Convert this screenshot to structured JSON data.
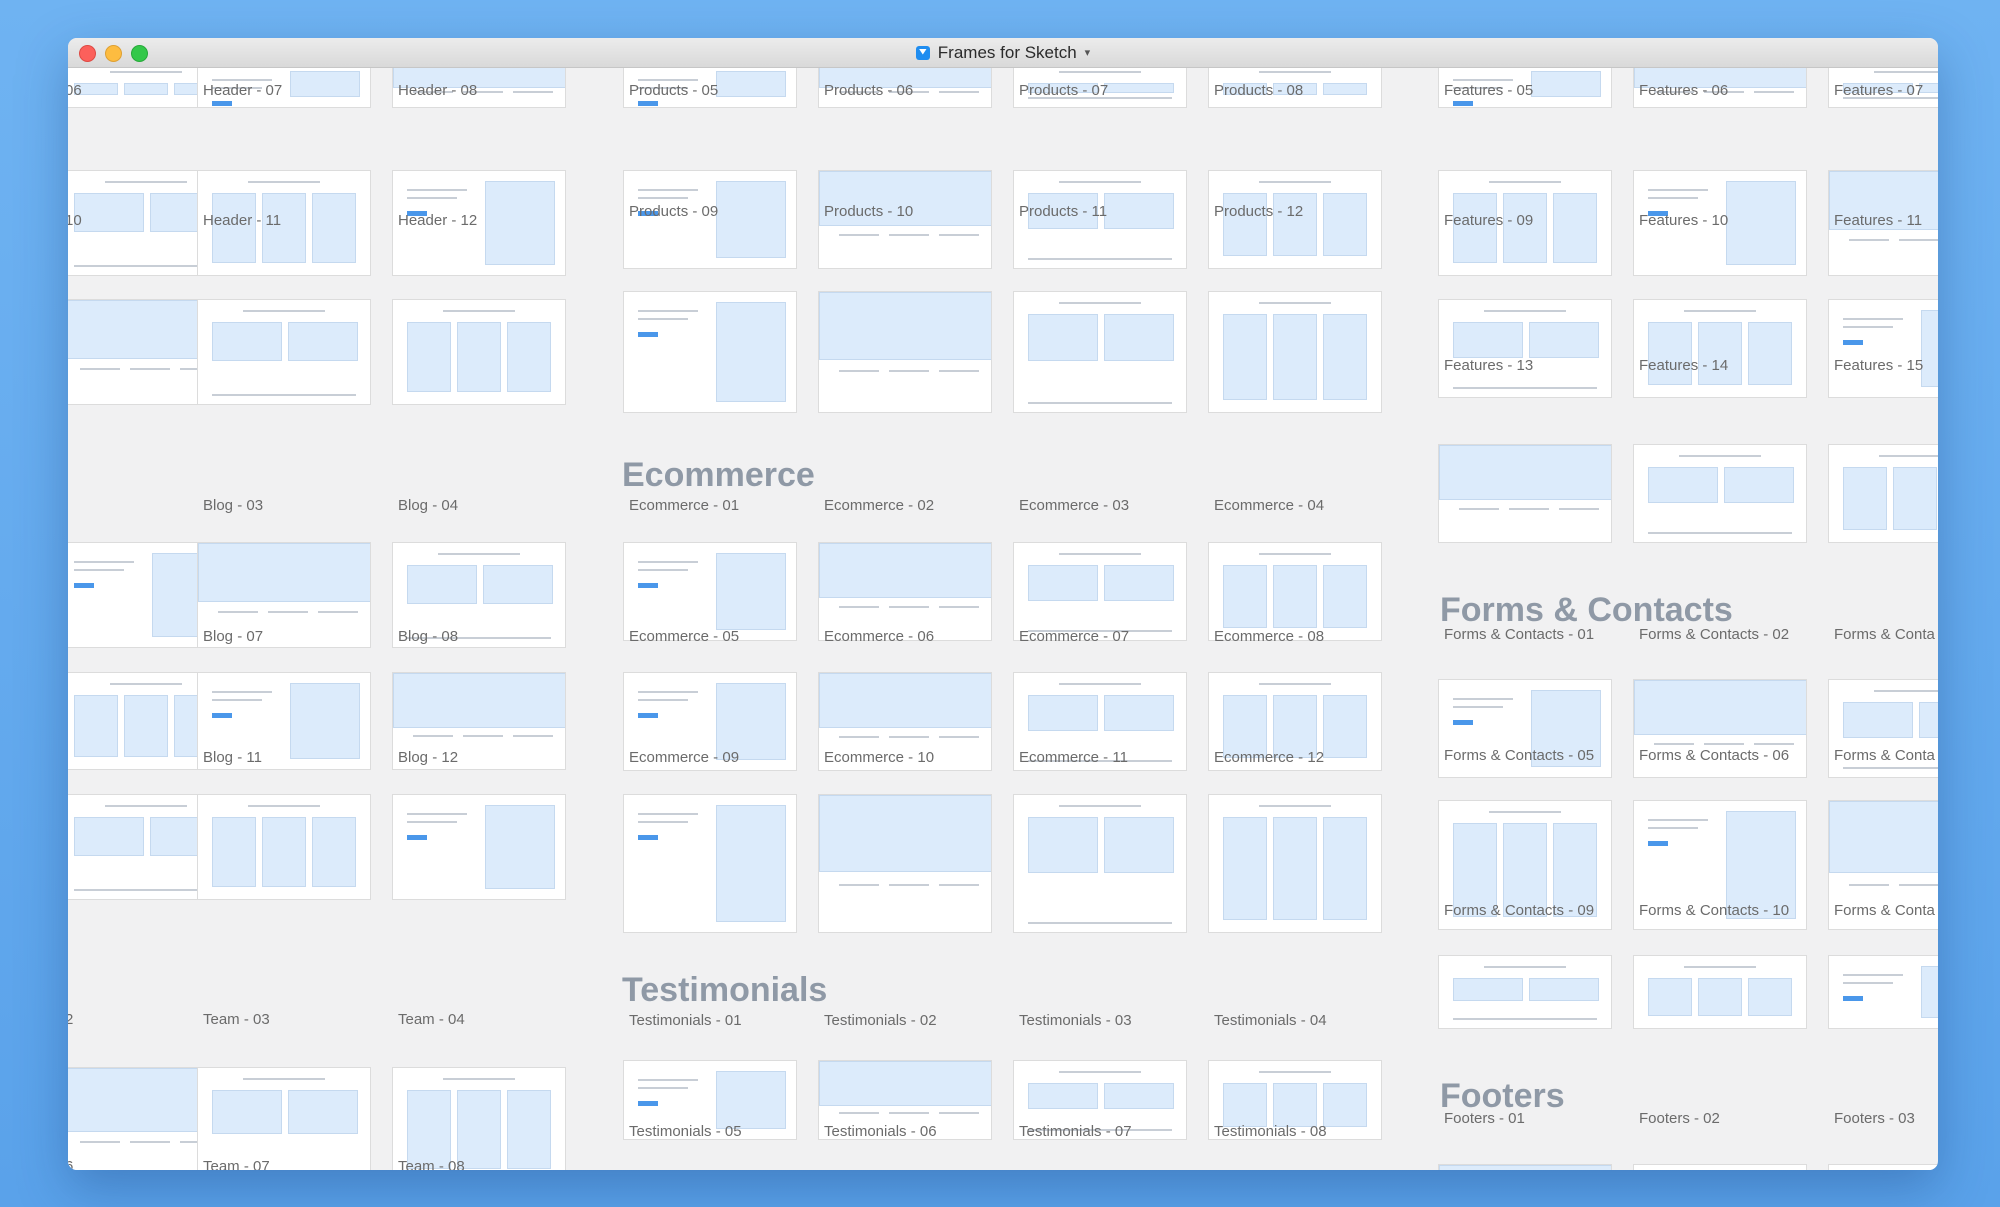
{
  "window": {
    "title": "Frames for Sketch",
    "dropdown_icon": "chevron-down-icon",
    "traffic_lights": [
      "close",
      "minimize",
      "maximize"
    ]
  },
  "colors": {
    "desktop": "#65abee",
    "accent": "#4a97ea",
    "placeholder_fill": "#dcebfb",
    "section_heading": "#8f99a6"
  },
  "canvas": {
    "sections": [
      "Ecommerce",
      "Testimonials",
      "Forms & Contacts",
      "Footers"
    ],
    "labels": [
      "06",
      "Header - 07",
      "Header - 08",
      "10",
      "Header - 11",
      "Header - 12",
      "Blog - 03",
      "Blog - 04",
      "Blog - 07",
      "Blog - 08",
      "Blog - 11",
      "Blog - 12",
      "2",
      "Team - 03",
      "Team - 04",
      "6",
      "Team - 07",
      "Team - 08",
      "Products - 05",
      "Products - 06",
      "Products - 07",
      "Products - 08",
      "Products - 09",
      "Products - 10",
      "Products - 11",
      "Products - 12",
      "Ecommerce - 01",
      "Ecommerce - 02",
      "Ecommerce - 03",
      "Ecommerce - 04",
      "Ecommerce - 05",
      "Ecommerce - 06",
      "Ecommerce - 07",
      "Ecommerce - 08",
      "Ecommerce - 09",
      "Ecommerce - 10",
      "Ecommerce - 11",
      "Ecommerce - 12",
      "Testimonials - 01",
      "Testimonials - 02",
      "Testimonials - 03",
      "Testimonials - 04",
      "Testimonials - 05",
      "Testimonials - 06",
      "Testimonials - 07",
      "Testimonials - 08",
      "Features - 05",
      "Features - 06",
      "Features - 07",
      "Features - 09",
      "Features - 10",
      "Features - 11",
      "Features - 13",
      "Features - 14",
      "Features - 15",
      "Forms & Contacts - 01",
      "Forms & Contacts - 02",
      "Forms & Conta",
      "Forms & Contacts - 05",
      "Forms & Contacts - 06",
      "Forms & Conta",
      "Forms & Contacts - 09",
      "Forms & Contacts - 10",
      "Forms & Conta",
      "Footers - 01",
      "Footers - 02",
      "Footers - 03"
    ]
  }
}
